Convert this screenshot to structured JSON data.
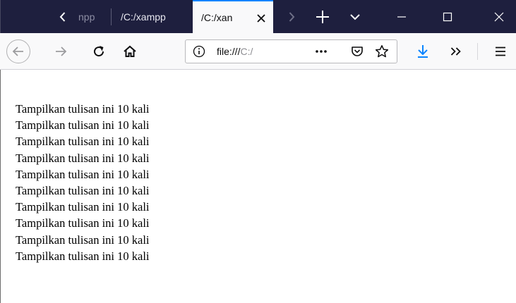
{
  "colors": {
    "tabbar_bg": "#1e1f3e",
    "active_tab_bg": "#f9f9fa",
    "active_tab_accent": "#0a84ff",
    "navbar_bg": "#f9f9fa",
    "download_accent": "#0a84ff"
  },
  "tabs": [
    {
      "label": "npp",
      "state": "inactive-partial"
    },
    {
      "label": "/C:/xampp",
      "state": "inactive"
    },
    {
      "label": "/C:/xan",
      "state": "active"
    }
  ],
  "tabbar": {
    "scroll_left_icon": "chevron-left-icon",
    "scroll_right_icon": "chevron-right-icon",
    "new_tab_icon": "plus-icon",
    "list_tabs_icon": "chevron-down-icon"
  },
  "window_controls": {
    "minimize_icon": "minimize-icon",
    "maximize_icon": "maximize-icon",
    "close_icon": "close-icon"
  },
  "navbar": {
    "back_icon": "arrow-left-icon",
    "forward_icon": "arrow-right-icon",
    "reload_icon": "reload-icon",
    "home_icon": "home-icon",
    "url_prefix": "file:///",
    "url_rest": "C:/",
    "page_actions_icon": "more-dots-icon",
    "pocket_icon": "pocket-icon",
    "bookmark_icon": "star-icon",
    "download_icon": "download-arrow-icon",
    "overflow_icon": "double-chevron-icon",
    "menu_icon": "hamburger-menu-icon"
  },
  "content": {
    "lines": [
      "Tampilkan tulisan ini 10 kali",
      "Tampilkan tulisan ini 10 kali",
      "Tampilkan tulisan ini 10 kali",
      "Tampilkan tulisan ini 10 kali",
      "Tampilkan tulisan ini 10 kali",
      "Tampilkan tulisan ini 10 kali",
      "Tampilkan tulisan ini 10 kali",
      "Tampilkan tulisan ini 10 kali",
      "Tampilkan tulisan ini 10 kali",
      "Tampilkan tulisan ini 10 kali"
    ]
  }
}
